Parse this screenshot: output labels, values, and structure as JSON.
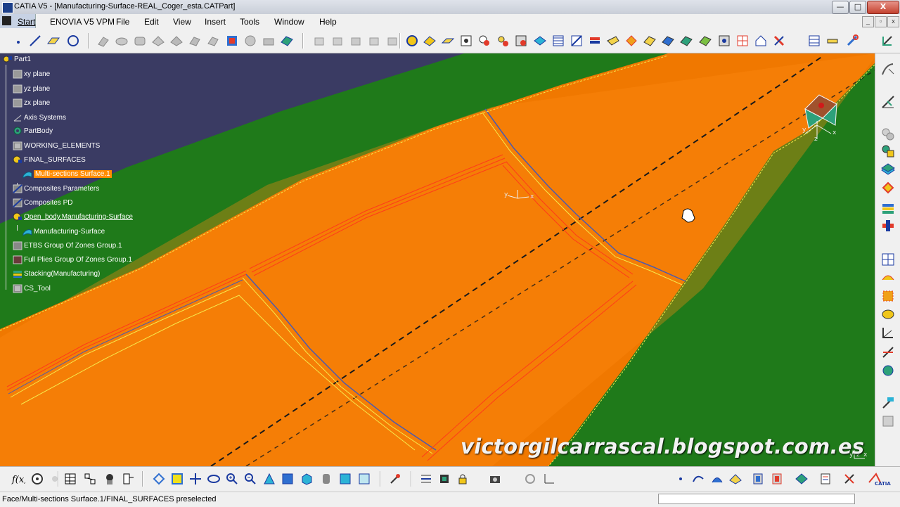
{
  "window": {
    "title": "CATIA V5 - [Manufacturing-Surface-REAL_Coger_esta.CATPart]",
    "minimize": "—",
    "maximize": "□",
    "close": "X"
  },
  "menu": {
    "items": [
      "Start",
      "ENOVIA V5 VPM",
      "File",
      "Edit",
      "View",
      "Insert",
      "Tools",
      "Window",
      "Help"
    ],
    "mdi_controls": [
      "_",
      "▫",
      "x"
    ]
  },
  "tree": {
    "nodes": [
      {
        "label": "Part1",
        "icon": "part-icon"
      },
      {
        "label": "xy plane",
        "icon": "plane-icon"
      },
      {
        "label": "yz plane",
        "icon": "plane-icon"
      },
      {
        "label": "zx plane",
        "icon": "plane-icon"
      },
      {
        "label": "Axis Systems",
        "icon": "axis-icon"
      },
      {
        "label": "PartBody",
        "icon": "gear-icon"
      },
      {
        "label": "WORKING_ELEMENTS",
        "icon": "geometrical-set-icon"
      },
      {
        "label": "FINAL_SURFACES",
        "icon": "geometrical-set-icon"
      },
      {
        "label": "Multi-sections Surface.1",
        "icon": "surface-icon",
        "selected": true
      },
      {
        "label": "Composites Parameters",
        "icon": "composites-icon"
      },
      {
        "label": "Composites PD",
        "icon": "composites-icon"
      },
      {
        "label": "Open_body.Manufacturing-Surface",
        "icon": "geometrical-set-icon"
      },
      {
        "label": "Manufacturing-Surface",
        "icon": "surface-icon"
      },
      {
        "label": "ETBS Group Of Zones Group.1",
        "icon": "zones-icon"
      },
      {
        "label": "Full Plies Group Of Zones Group.1",
        "icon": "zones-icon"
      },
      {
        "label": "Stacking(Manufacturing)",
        "icon": "stacking-icon"
      },
      {
        "label": "CS_Tool",
        "icon": "geometrical-set-icon"
      }
    ]
  },
  "viewport": {
    "watermark": "victorgilcarrascal.blogspot.com.es",
    "compass_labels": [
      "y",
      "x",
      "z"
    ],
    "colors": {
      "background": "#3a3b63",
      "surface": "#f07800",
      "surface_border": "#1f7a1a"
    }
  },
  "status": {
    "text": "Face/Multi-sections Surface.1/FINAL_SURFACES preselected"
  },
  "toolbar_icons": [
    "point-icon",
    "line-icon",
    "plane-icon",
    "circle-icon",
    "sketch-icon",
    "extrude-icon",
    "revolve-icon",
    "sphere-icon",
    "cylinder-icon",
    "offset-icon",
    "sweep-icon",
    "fill-icon",
    "multi-section-icon",
    "blend-icon",
    "join-icon",
    "split-icon",
    "trim-icon",
    "boundary-icon",
    "extract-icon",
    "fillet-icon",
    "translate-icon",
    "rotate-icon",
    "symmetry-icon",
    "scaling-icon",
    "affinity-icon",
    "extrapolate-icon",
    "invert-icon",
    "near-icon",
    "ply-icon",
    "zone-icon",
    "stacking-icon",
    "core-icon",
    "flatten-icon",
    "producibility-icon"
  ],
  "bottom_icons": [
    "formula-icon",
    "knowledge-icon",
    "measure-icon",
    "table-icon",
    "catalog-icon",
    "apply-material-icon",
    "fly-icon",
    "fit-all-icon",
    "pan-icon",
    "rotate-view-icon",
    "zoom-in-icon",
    "zoom-out-icon",
    "normal-view-icon",
    "iso-view-icon",
    "cube-view-icon",
    "hide-show-icon",
    "swap-icon",
    "shading-icon",
    "update-icon",
    "axis-icon",
    "create-datum-icon",
    "only-current-body-icon",
    "hand-icon",
    "camera-icon",
    "reframe-icon",
    "compass-icon",
    "snap-icon",
    "constraint-icon",
    "spline-icon",
    "curve-icon",
    "analysis-icon",
    "draft-icon",
    "connect-icon",
    "catia-logo"
  ]
}
